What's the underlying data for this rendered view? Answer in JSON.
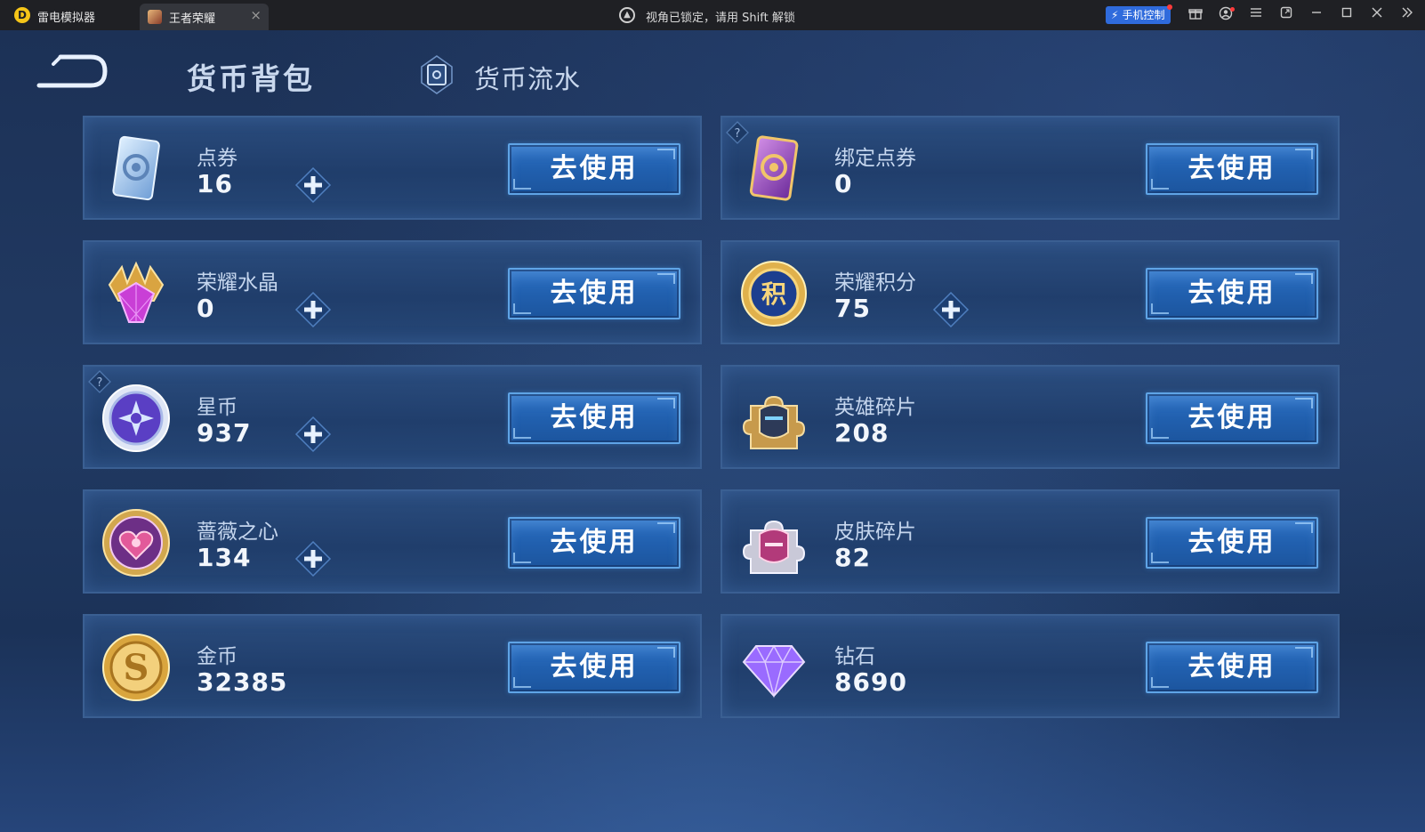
{
  "window": {
    "app_name": "雷电模拟器",
    "tab_label": "王者荣耀",
    "tab_close": "×",
    "lock_notice": "视角已锁定，请用 Shift 解锁",
    "phone_control_label": "手机控制"
  },
  "header": {
    "title": "货币背包",
    "flow_label": "货币流水"
  },
  "use_label": "去使用",
  "currencies": [
    {
      "name": "点券",
      "value": "16",
      "icon": "voucher-icon",
      "has_plus": true,
      "has_help": false
    },
    {
      "name": "绑定点券",
      "value": "0",
      "icon": "bound-voucher-icon",
      "has_plus": false,
      "has_help": true
    },
    {
      "name": "荣耀水晶",
      "value": "0",
      "icon": "glory-crystal-icon",
      "has_plus": true,
      "has_help": false
    },
    {
      "name": "荣耀积分",
      "value": "75",
      "icon": "glory-points-icon",
      "has_plus": true,
      "has_help": false
    },
    {
      "name": "星币",
      "value": "937",
      "icon": "star-coin-icon",
      "has_plus": true,
      "has_help": true
    },
    {
      "name": "英雄碎片",
      "value": "208",
      "icon": "hero-fragment-icon",
      "has_plus": false,
      "has_help": false
    },
    {
      "name": "蔷薇之心",
      "value": "134",
      "icon": "rose-heart-icon",
      "has_plus": true,
      "has_help": false
    },
    {
      "name": "皮肤碎片",
      "value": "82",
      "icon": "skin-fragment-icon",
      "has_plus": false,
      "has_help": false
    },
    {
      "name": "金币",
      "value": "32385",
      "icon": "gold-coin-icon",
      "has_plus": false,
      "has_help": false
    },
    {
      "name": "钻石",
      "value": "8690",
      "icon": "diamond-icon",
      "has_plus": false,
      "has_help": false
    }
  ]
}
